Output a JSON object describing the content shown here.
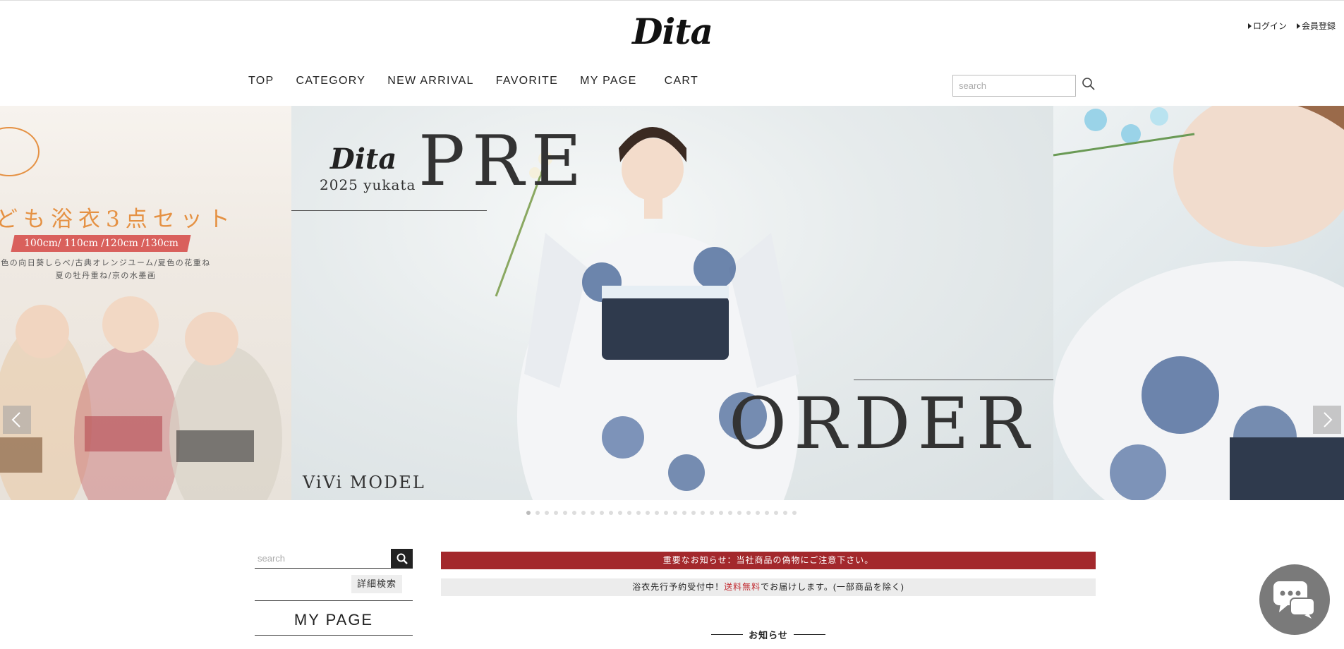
{
  "header": {
    "logo_text": "Dita",
    "login": "ログイン",
    "register": "会員登録"
  },
  "nav": {
    "items": [
      "TOP",
      "CATEGORY",
      "NEW ARRIVAL",
      "FAVORITE",
      "MY PAGE",
      "CART"
    ]
  },
  "search": {
    "placeholder": "search"
  },
  "hero": {
    "left_slide": {
      "title": "ども浴衣3点セット",
      "sizes": "100cm/ 110cm /120cm /130cm",
      "colors_line1": "色の向日葵しらべ/古典オレンジユーム/夏色の花重ね",
      "colors_line2": "夏の牡丹重ね/京の水墨画"
    },
    "main_slide": {
      "brand": "Dita",
      "year": "2025 yukata",
      "pre": "PRE",
      "order": "ORDER",
      "model": "ViVi MODEL"
    },
    "dot_count": 30,
    "active_dot": 0
  },
  "sidebar": {
    "search_placeholder": "search",
    "advanced_search": "詳細検索",
    "mypage": "MY PAGE"
  },
  "notices": {
    "important": "重要なお知らせ：当社商品の偽物にご注意下さい。",
    "preorder_prefix": "浴衣先行予約受付中！",
    "preorder_highlight": "送料無料",
    "preorder_suffix": "でお届けします。(一部商品を除く)"
  },
  "news": {
    "heading": "お知らせ"
  },
  "colors": {
    "notice_red": "#a3282c",
    "accent_orange": "#e59143",
    "sizes_band": "#d9605c",
    "highlight_red": "#c1272d",
    "chat_gray": "#7a7a7a"
  }
}
